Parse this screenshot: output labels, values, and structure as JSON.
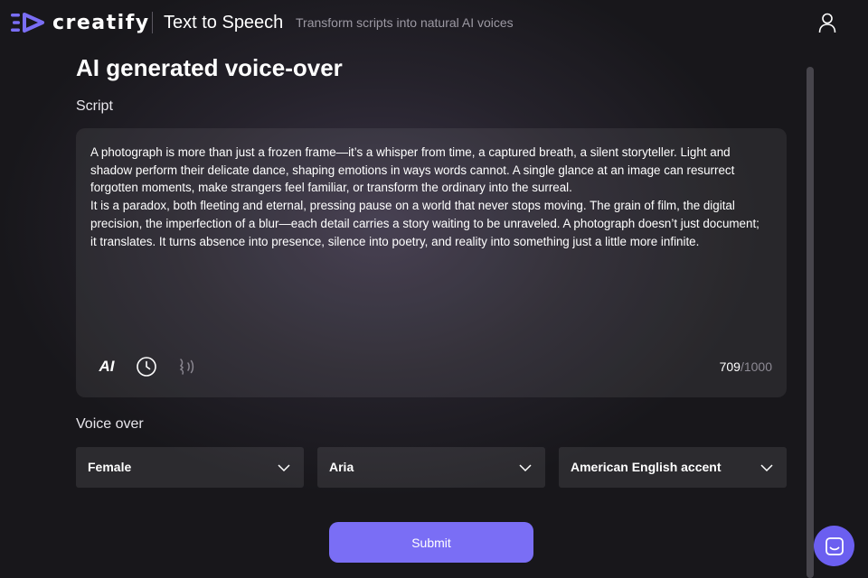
{
  "brand": {
    "name": "creatify",
    "accent": "#7a6ef5"
  },
  "header": {
    "title": "Text to Speech",
    "subtitle": "Transform scripts into natural AI voices"
  },
  "page": {
    "title": "AI generated voice-over"
  },
  "script": {
    "label": "Script",
    "text": "A photograph is more than just a frozen frame—it’s a whisper from time, a captured breath, a silent storyteller. Light and shadow perform their delicate dance, shaping emotions in ways words cannot. A single glance at an image can resurrect forgotten moments, make strangers feel familiar, or transform the ordinary into the surreal.\nIt is a paradox, both fleeting and eternal, pressing pause on a world that never stops moving. The grain of film, the digital precision, the imperfection of a blur—each detail carries a story waiting to be unraveled. A photograph doesn’t just document; it translates. It turns absence into presence, silence into poetry, and reality into something just a little more infinite.",
    "tools": {
      "ai_label": "AI"
    },
    "char_count": "709",
    "char_max": "/1000"
  },
  "voice_over": {
    "label": "Voice over",
    "gender": "Female",
    "voice": "Aria",
    "accent": "American English accent"
  },
  "submit": {
    "label": "Submit"
  },
  "icons": [
    "logo-icon",
    "user-icon",
    "history-icon",
    "voice-icon",
    "chevron-down-icon",
    "chat-icon"
  ]
}
